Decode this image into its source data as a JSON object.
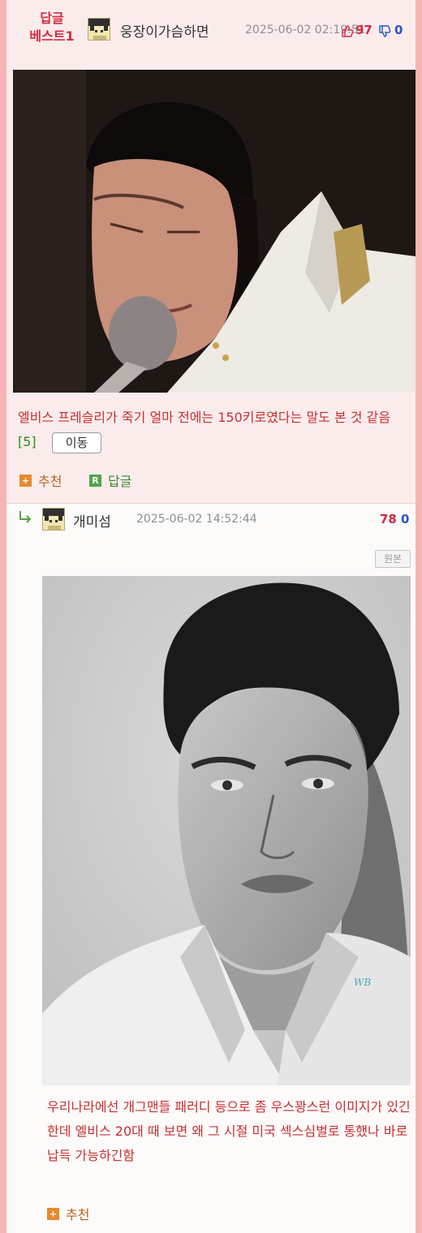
{
  "best_comment": {
    "badge": "답글\n베스트1",
    "nickname": "웅장이가슴하면",
    "date": "2025-06-02 02:19:51",
    "upvotes": "97",
    "downvotes": "0",
    "text": "엘비스 프레슬리가 죽기 얼마 전에는 150키로였다는 말도 본 것 같음",
    "reply_count": "[5]",
    "move_label": "이동",
    "recommend_label": "추천",
    "reply_label": "답글",
    "recommend_icon": "plus-square-icon",
    "reply_icon": "r-square-icon"
  },
  "reply": {
    "nickname": "개미섬",
    "date": "2025-06-02 14:52:44",
    "upvotes": "78",
    "downvotes": "0",
    "origin_label": "원본",
    "watermark": "WB",
    "text": "우리나라에선 개그맨들 패러디 등으로 좀 우스꽝스런 이미지가 있긴 한데 엘비스 20대 때 보면 왜 그 시절 미국 섹스심벌로 통했나 바로 납득 가능하긴함",
    "recommend_label": "추천"
  },
  "colors": {
    "frame": "#f7b4b4",
    "best_bg": "#fbecec",
    "accent_red": "#d22b43",
    "text_red": "#c63131",
    "reply_green": "#2b8f20",
    "down_blue": "#2a53c9"
  }
}
